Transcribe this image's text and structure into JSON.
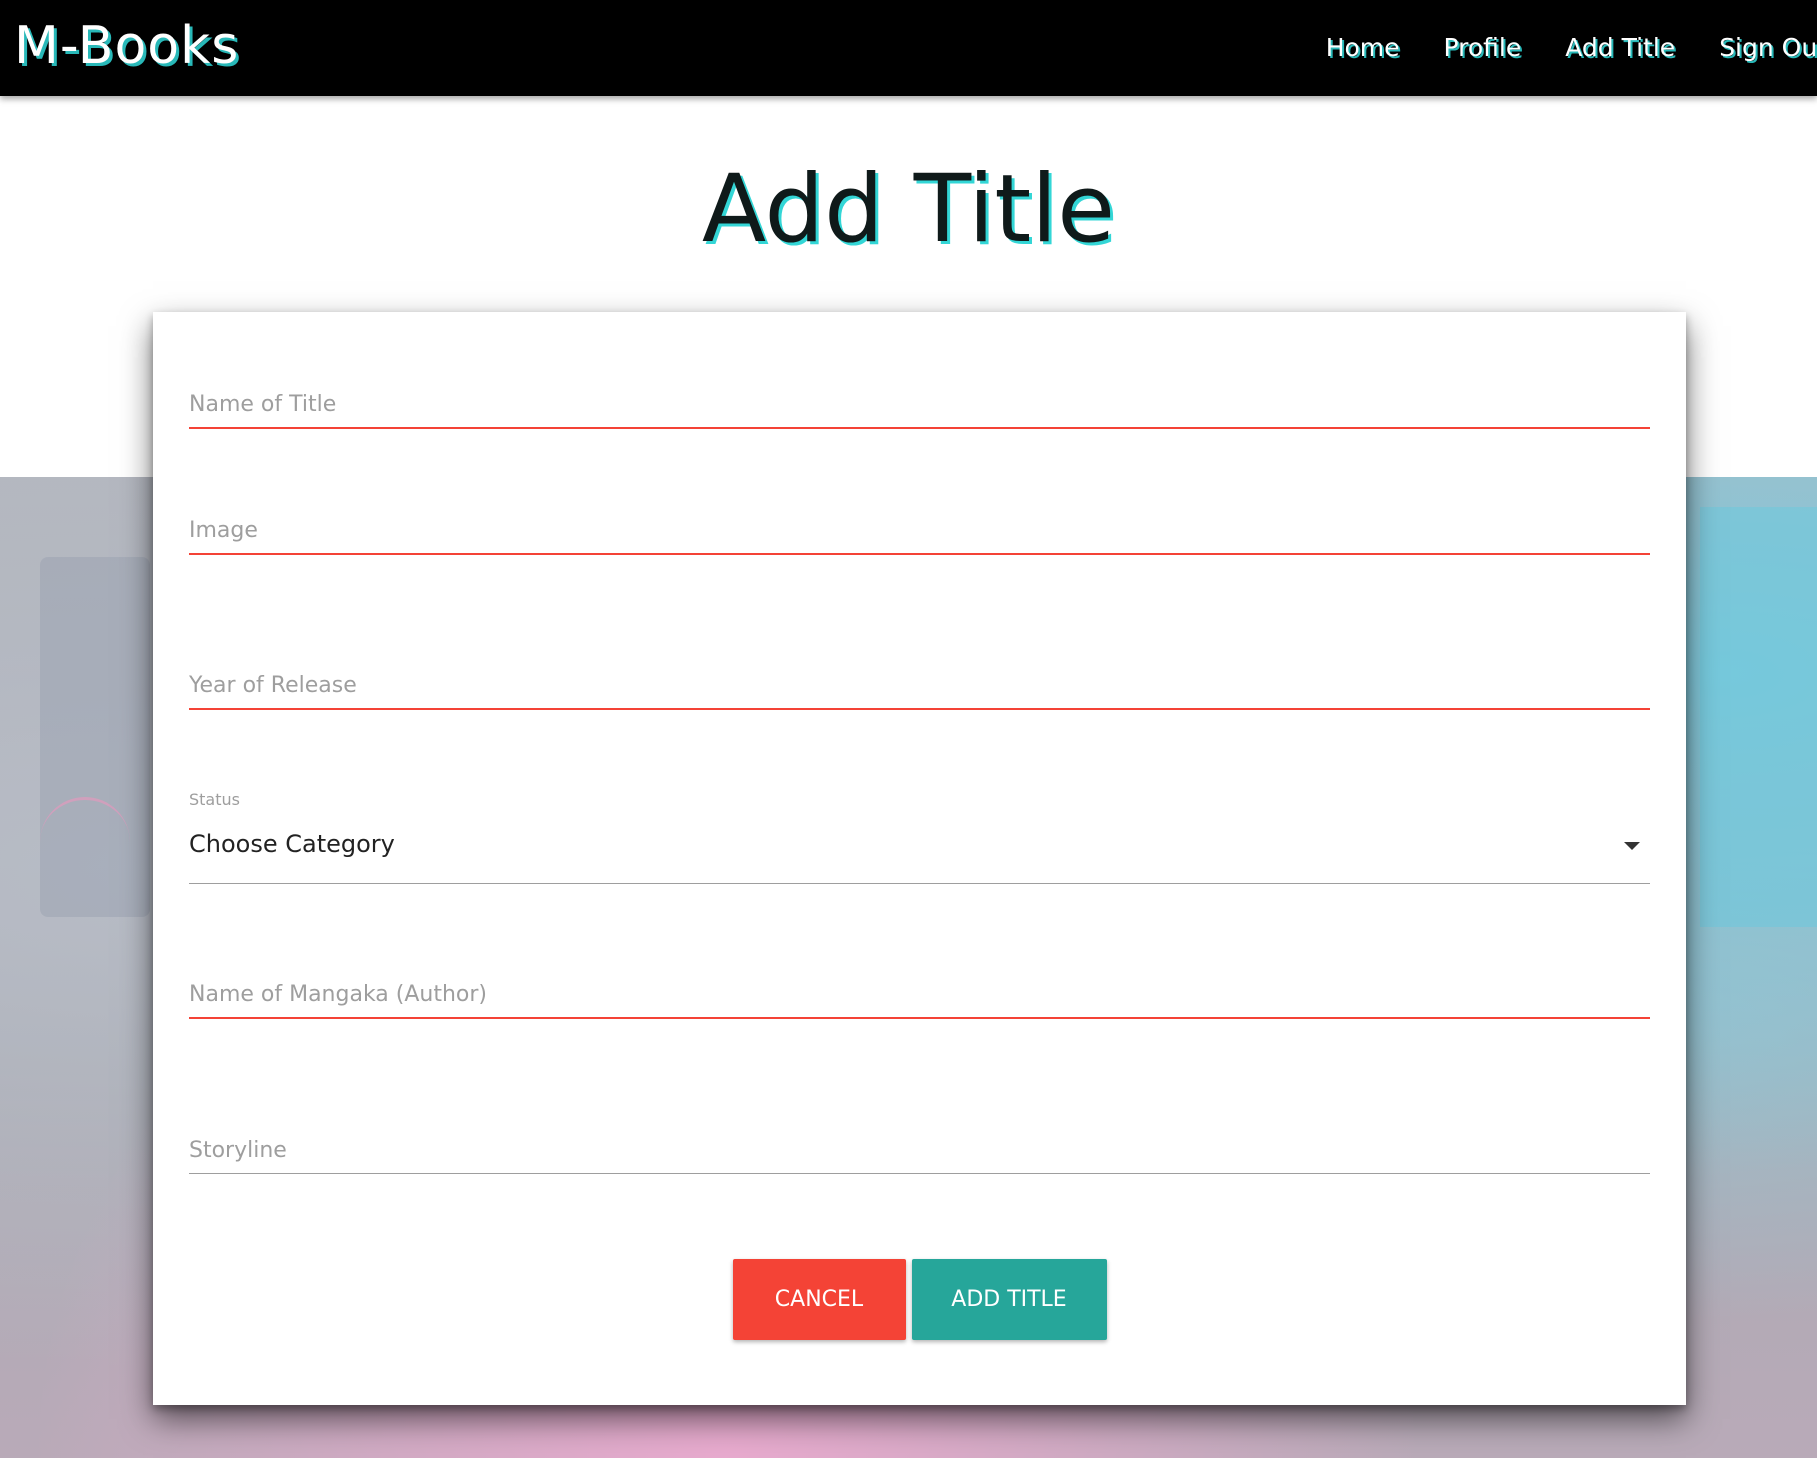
{
  "navbar": {
    "brand": "M-Books",
    "links": [
      {
        "label": "Home"
      },
      {
        "label": "Profile"
      },
      {
        "label": "Add Title"
      },
      {
        "label": "Sign Out"
      }
    ]
  },
  "page": {
    "title": "Add Title"
  },
  "form": {
    "name_of_title": {
      "placeholder": "Name of Title",
      "value": ""
    },
    "image": {
      "placeholder": "Image",
      "value": ""
    },
    "year_of_release": {
      "placeholder": "Year of Release",
      "value": ""
    },
    "status": {
      "label": "Status",
      "selected": "Choose Category"
    },
    "mangaka": {
      "placeholder": "Name of Mangaka (Author)",
      "value": ""
    },
    "storyline": {
      "placeholder": "Storyline",
      "value": ""
    },
    "cancel_label": "Cancel",
    "add_label": "Add Title"
  },
  "colors": {
    "navbar_bg": "#000000",
    "accent_cyan": "#33d6d6",
    "error_red": "#f44336",
    "teal_button": "#26a69a"
  }
}
